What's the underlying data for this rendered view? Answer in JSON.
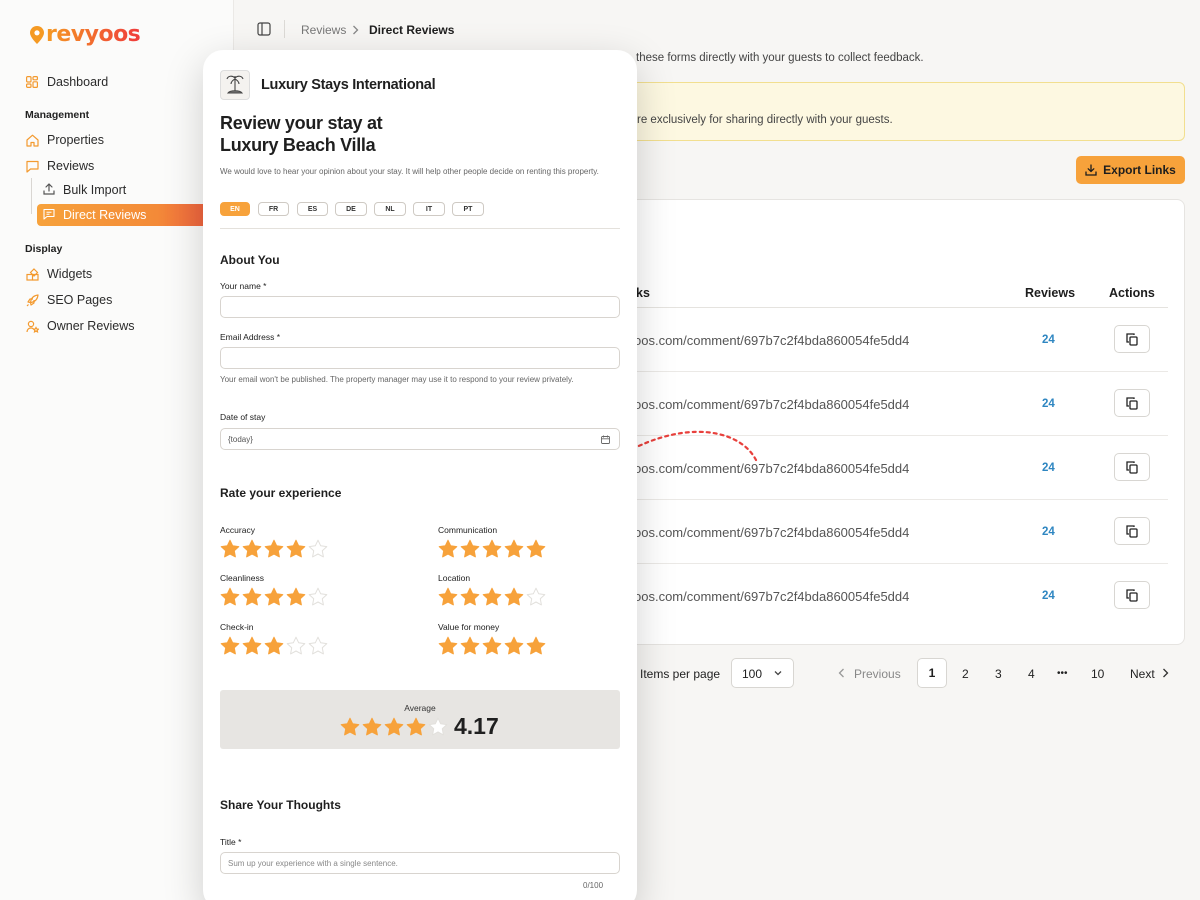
{
  "brand": {
    "logo_text": "revyoos"
  },
  "sidebar": {
    "dashboard": "Dashboard",
    "management_heading": "Management",
    "properties": "Properties",
    "reviews": "Reviews",
    "bulk_import": "Bulk Import",
    "direct_reviews": "Direct Reviews",
    "display_heading": "Display",
    "widgets": "Widgets",
    "seo_pages": "SEO Pages",
    "owner_reviews": "Owner Reviews"
  },
  "breadcrumb": {
    "parent": "Reviews",
    "current": "Direct Reviews"
  },
  "page": {
    "subtitle": "these forms directly with your guests to collect feedback.",
    "notice_text": "re exclusively for sharing directly with your guests.",
    "export_label": "Export Links"
  },
  "table": {
    "headers": {
      "link": "ks",
      "reviews": "Reviews",
      "actions": "Actions"
    },
    "rows": [
      {
        "link": "oos.com/comment/697b7c2f4bda860054fe5dd4",
        "count": "24"
      },
      {
        "link": "oos.com/comment/697b7c2f4bda860054fe5dd4",
        "count": "24"
      },
      {
        "link": "oos.com/comment/697b7c2f4bda860054fe5dd4",
        "count": "24"
      },
      {
        "link": "oos.com/comment/697b7c2f4bda860054fe5dd4",
        "count": "24"
      },
      {
        "link": "oos.com/comment/697b7c2f4bda860054fe5dd4",
        "count": "24"
      }
    ]
  },
  "pagination": {
    "items_label": "Items per page",
    "per_page": "100",
    "previous": "Previous",
    "pages": [
      "1",
      "2",
      "3",
      "4",
      "•••",
      "10"
    ],
    "next": "Next"
  },
  "form": {
    "org": "Luxury Stays International",
    "title_line1": "Review your stay at",
    "title_line2": "Luxury Beach Villa",
    "intro": "We would love to hear your opinion about your stay. It will help other people decide on renting this property.",
    "languages": [
      "EN",
      "FR",
      "ES",
      "DE",
      "NL",
      "IT",
      "PT"
    ],
    "active_language": "EN",
    "about_heading": "About You",
    "name_label": "Your name *",
    "email_label": "Email Address *",
    "email_help": "Your email won't be published. The property manager may use it to respond to your review privately.",
    "date_label": "Date of stay",
    "date_value": "{today}",
    "rate_heading": "Rate your experience",
    "ratings": [
      {
        "label": "Accuracy",
        "stars": 4
      },
      {
        "label": "Communication",
        "stars": 5
      },
      {
        "label": "Cleanliness",
        "stars": 4
      },
      {
        "label": "Location",
        "stars": 4
      },
      {
        "label": "Check-in",
        "stars": 3
      },
      {
        "label": "Value for money",
        "stars": 5
      }
    ],
    "average_label": "Average",
    "average_value": "4.17",
    "average_stars": 4,
    "thoughts_heading": "Share Your Thoughts",
    "title_label": "Title *",
    "title_placeholder": "Sum up your experience with a single sentence.",
    "title_counter": "0/100"
  },
  "colors": {
    "accent": "#f7a23b",
    "accent_red": "#ee4a44",
    "link_count": "#2e86c1",
    "star_off": "#e2e0dc"
  }
}
